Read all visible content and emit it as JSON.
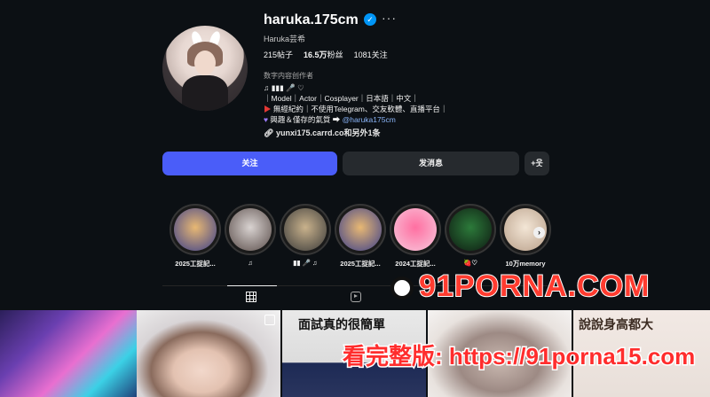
{
  "profile": {
    "username": "haruka.175cm",
    "verified_icon": "✓",
    "more_icon": "···",
    "full_name": "Haruka芸希",
    "stats": {
      "posts": "215帖子",
      "followers_num": "16.5万",
      "followers_label": "粉丝",
      "following": "1081关注"
    },
    "category": "数字内容创作者",
    "bio": {
      "line1": "♫ ▮▮▮ 🎤 ♡",
      "line2": "｜Model｜Actor｜Cosplayer｜日本語｜中文｜",
      "line3": "無經紀約｜不使用Telegram、交友軟體、直播平台｜",
      "line4_prefix": "興趣＆僅存的氣質 ➡ ",
      "line4_mention": "@haruka175cm"
    },
    "link": "yunxi175.carrd.co和另外1条"
  },
  "actions": {
    "follow": "关注",
    "message": "发消息",
    "add_user": "+웃"
  },
  "highlights": [
    {
      "label": "2025工捉記...",
      "color1": "#e8b873",
      "color2": "#3b3f8a"
    },
    {
      "label": "♫",
      "color1": "#d9d3d1",
      "color2": "#5a4d4a"
    },
    {
      "label": "▮▮ 🎤 ♫",
      "color1": "#c9b28c",
      "color2": "#3a3a3a"
    },
    {
      "label": "2025工捉記...",
      "color1": "#e8b873",
      "color2": "#3b3f8a"
    },
    {
      "label": "2024工捉記...",
      "color1": "#ff6fa1",
      "color2": "#f7c9dd"
    },
    {
      "label": "🍓♡",
      "color1": "#2c7a3a",
      "color2": "#0e1a12"
    },
    {
      "label": "10万memory",
      "color1": "#f3e6d6",
      "color2": "#b9a08a"
    }
  ],
  "posts": {
    "caption_3": "面試真的很簡單",
    "caption_5": "說說身高都大"
  },
  "watermark": {
    "brand": "91PORNA.COM",
    "promo": "看完整版: https://91porna15.com"
  }
}
